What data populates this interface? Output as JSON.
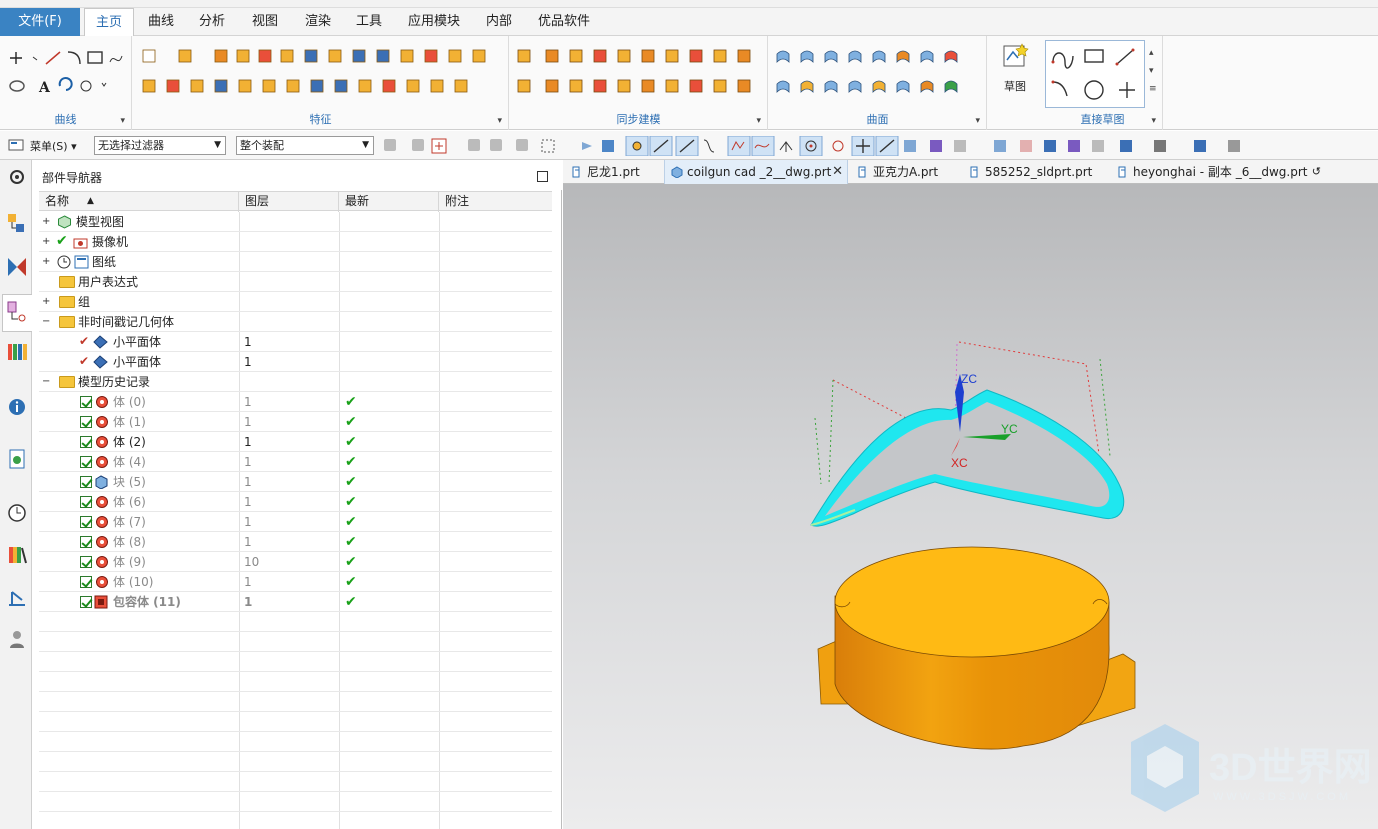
{
  "menu": {
    "file": "文件(F)",
    "tabs": [
      "主页",
      "曲线",
      "分析",
      "视图",
      "渲染",
      "工具",
      "应用模块",
      "内部",
      "优品软件"
    ]
  },
  "ribbon": {
    "groups": {
      "curve": "曲线",
      "feature": "特征",
      "sync": "同步建模",
      "surface": "曲面",
      "sketch": "草图",
      "direct_sketch": "直接草图"
    }
  },
  "toolbar": {
    "menu_label": "菜单(S)",
    "filter": "无选择过滤器",
    "assembly": "整个装配"
  },
  "navigator": {
    "title": "部件导航器",
    "columns": [
      "名称",
      "图层",
      "最新",
      "附注"
    ],
    "rows": [
      {
        "name": "模型视图",
        "layer": "",
        "latest": ""
      },
      {
        "name": "摄像机",
        "layer": "",
        "latest": ""
      },
      {
        "name": "图纸",
        "layer": "",
        "latest": ""
      },
      {
        "name": "用户表达式",
        "layer": "",
        "latest": ""
      },
      {
        "name": "组",
        "layer": "",
        "latest": ""
      },
      {
        "name": "非时间戳记几何体",
        "layer": "",
        "latest": ""
      },
      {
        "name": "小平面体",
        "layer": "1",
        "latest": ""
      },
      {
        "name": "小平面体",
        "layer": "1",
        "latest": ""
      },
      {
        "name": "模型历史记录",
        "layer": "",
        "latest": ""
      },
      {
        "name": "体 (0)",
        "layer": "1",
        "latest": "✔"
      },
      {
        "name": "体 (1)",
        "layer": "1",
        "latest": "✔"
      },
      {
        "name": "体 (2)",
        "layer": "1",
        "latest": "✔"
      },
      {
        "name": "体 (4)",
        "layer": "1",
        "latest": "✔"
      },
      {
        "name": "块 (5)",
        "layer": "1",
        "latest": "✔"
      },
      {
        "name": "体 (6)",
        "layer": "1",
        "latest": "✔"
      },
      {
        "name": "体 (7)",
        "layer": "1",
        "latest": "✔"
      },
      {
        "name": "体 (8)",
        "layer": "1",
        "latest": "✔"
      },
      {
        "name": "体 (9)",
        "layer": "10",
        "latest": "✔"
      },
      {
        "name": "体 (10)",
        "layer": "1",
        "latest": "✔"
      },
      {
        "name": "包容体 (11)",
        "layer": "1",
        "latest": "✔"
      }
    ]
  },
  "documents": [
    "尼龙1.prt",
    "coilgun cad _2__dwg.prt",
    "亚克力A.prt",
    "585252_sldprt.prt",
    "heyonghai - 副本 _6__dwg.prt"
  ],
  "viewport": {
    "axis_z": "ZC",
    "axis_y": "YC",
    "axis_x": "XC",
    "watermark": "3D世界网",
    "watermark_url": "WWW.3DSJW.COM"
  },
  "colors": {
    "accent": "#3a83c3",
    "cyan_curve": "#1fe7ef",
    "part_orange": "#f2a310"
  }
}
